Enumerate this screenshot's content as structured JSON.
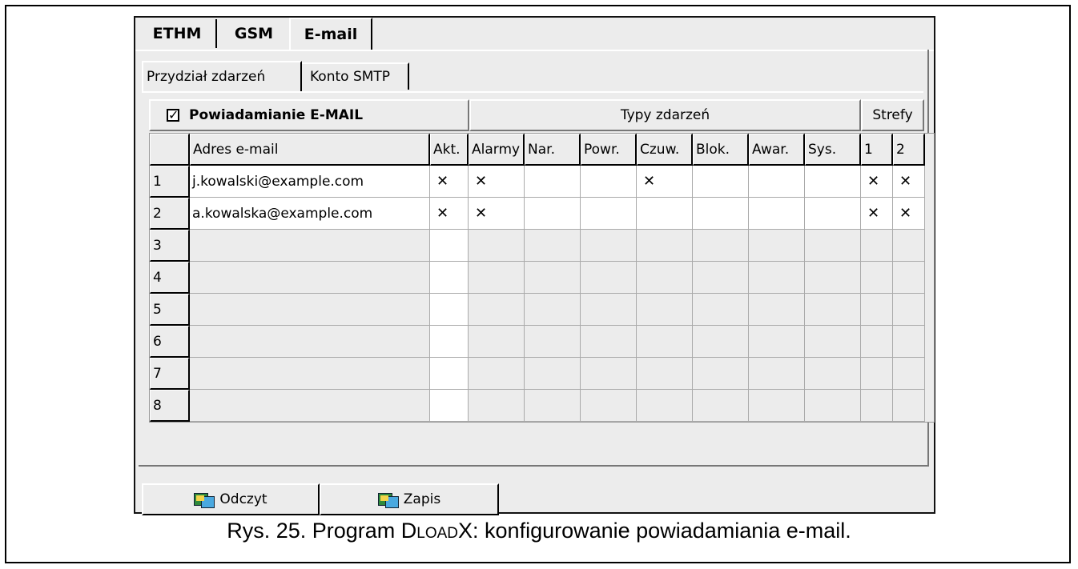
{
  "tabs": {
    "top": [
      "ETHM",
      "GSM",
      "E-mail"
    ],
    "sub": [
      "Przydział zdarzeń",
      "Konto SMTP"
    ]
  },
  "groups": {
    "notify_label": "Powiadamianie E-MAIL",
    "notify_checked": true,
    "event_types": "Typy zdarzeń",
    "zones": "Strefy"
  },
  "table": {
    "headers": [
      "Adres e-mail",
      "Akt.",
      "Alarmy",
      "Nar.",
      "Powr.",
      "Czuw.",
      "Blok.",
      "Awar.",
      "Sys.",
      "1",
      "2"
    ],
    "rows": [
      {
        "n": "1",
        "email": "j.kowalski@example.com",
        "marks": [
          "X",
          "X",
          "",
          "",
          "X",
          "",
          "",
          "",
          "X",
          "X"
        ]
      },
      {
        "n": "2",
        "email": "a.kowalska@example.com",
        "marks": [
          "X",
          "X",
          "",
          "",
          "",
          "",
          "",
          "",
          "X",
          "X"
        ]
      },
      {
        "n": "3",
        "email": "",
        "marks": [
          "",
          "",
          "",
          "",
          "",
          "",
          "",
          "",
          "",
          ""
        ]
      },
      {
        "n": "4",
        "email": "",
        "marks": [
          "",
          "",
          "",
          "",
          "",
          "",
          "",
          "",
          "",
          ""
        ]
      },
      {
        "n": "5",
        "email": "",
        "marks": [
          "",
          "",
          "",
          "",
          "",
          "",
          "",
          "",
          "",
          ""
        ]
      },
      {
        "n": "6",
        "email": "",
        "marks": [
          "",
          "",
          "",
          "",
          "",
          "",
          "",
          "",
          "",
          ""
        ]
      },
      {
        "n": "7",
        "email": "",
        "marks": [
          "",
          "",
          "",
          "",
          "",
          "",
          "",
          "",
          "",
          ""
        ]
      },
      {
        "n": "8",
        "email": "",
        "marks": [
          "",
          "",
          "",
          "",
          "",
          "",
          "",
          "",
          "",
          ""
        ]
      }
    ]
  },
  "buttons": {
    "read": "Odczyt",
    "write": "Zapis"
  },
  "caption": {
    "prefix": "Rys. 25. Program D",
    "smallcaps": "LOAD",
    "suffix": "X: konfigurowanie powiadamiania e-mail."
  }
}
